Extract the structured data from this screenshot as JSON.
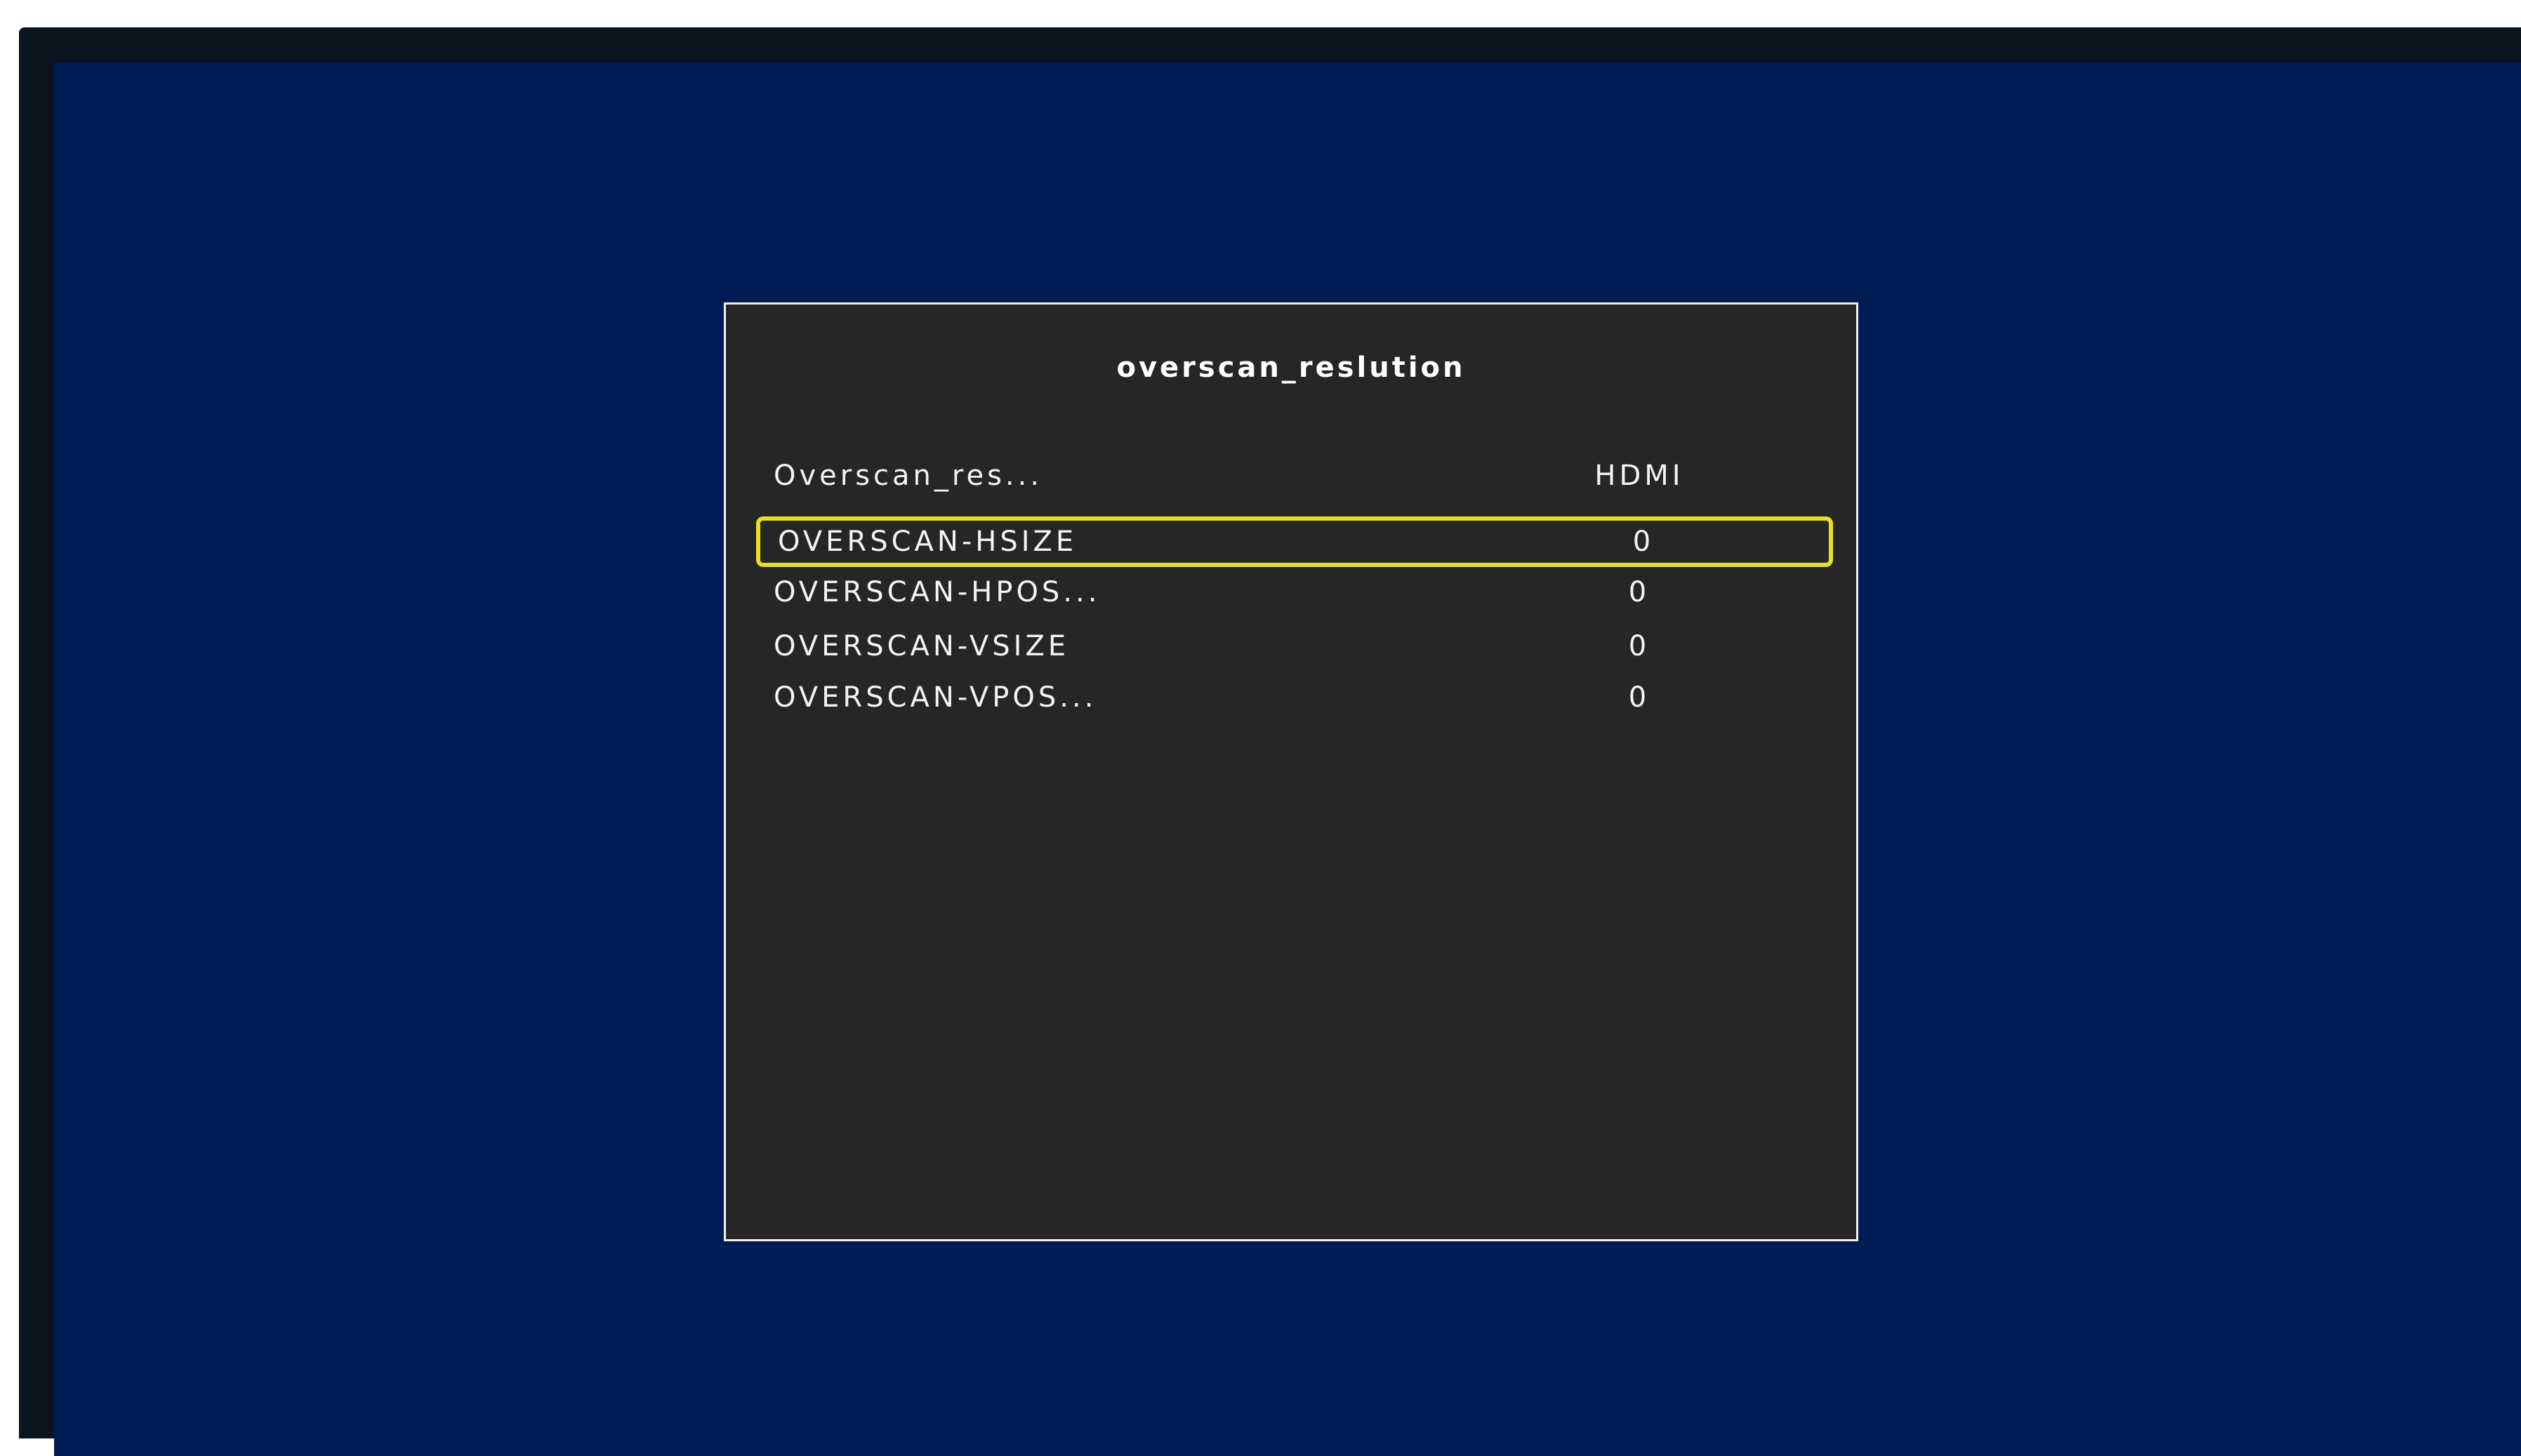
{
  "screen": {
    "background_color": "#001c54",
    "bezel_color": "#0b141e"
  },
  "menu": {
    "title": "overscan_reslution",
    "highlight_color": "#e6e01e",
    "items": [
      {
        "label": "Overscan_res...",
        "value": "HDMI",
        "selected": false
      },
      {
        "label": "OVERSCAN-HSIZE",
        "value": "0",
        "selected": true
      },
      {
        "label": "OVERSCAN-HPOS...",
        "value": "0",
        "selected": false
      },
      {
        "label": "OVERSCAN-VSIZE",
        "value": "0",
        "selected": false
      },
      {
        "label": "OVERSCAN-VPOS...",
        "value": "0",
        "selected": false
      }
    ]
  }
}
